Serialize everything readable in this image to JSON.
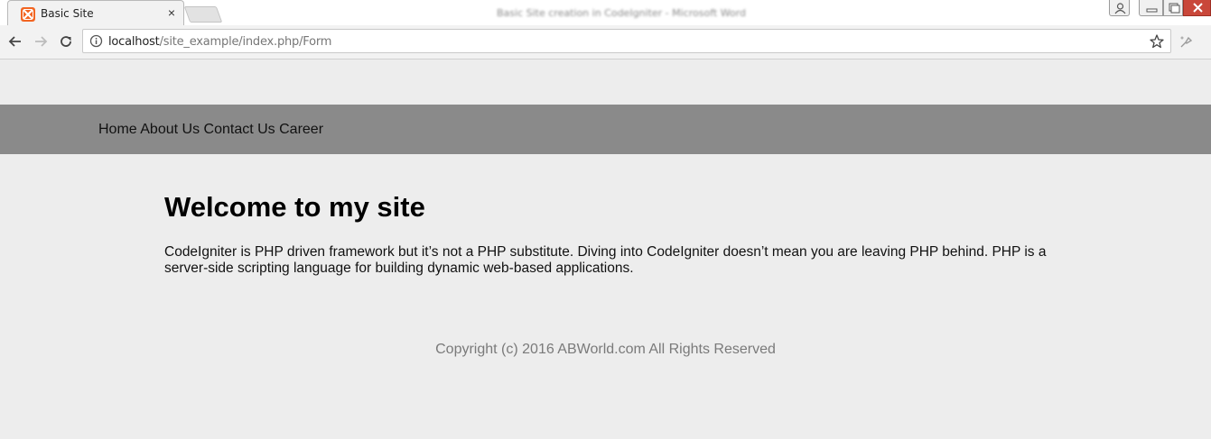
{
  "browser": {
    "tab_title": "Basic Site",
    "tab_close": "×",
    "window_title": "Basic Site creation in CodeIgniter - Microsoft Word",
    "url_host": "localhost",
    "url_path": "/site_example/index.php/Form",
    "icons": [
      "back-arrow-icon",
      "forward-arrow-icon",
      "reload-icon",
      "info-icon",
      "star-icon",
      "extension-icon",
      "profile-icon",
      "minimize-icon",
      "maximize-icon",
      "close-window-icon"
    ],
    "favicon_color": "#f26522"
  },
  "site": {
    "nav": [
      "Home",
      "About Us",
      "Contact Us",
      "Career"
    ],
    "nav_bg": "#8a8a8a",
    "heading": "Welcome to my site",
    "body": "CodeIgniter is PHP driven framework but it’s not a PHP substitute. Diving into CodeIgniter doesn’t mean you are leaving PHP behind. PHP is a server-side scripting language for building dynamic web-based applications.",
    "footer": "Copyright (c) 2016 ABWorld.com All Rights Reserved",
    "page_bg": "#ededed"
  }
}
